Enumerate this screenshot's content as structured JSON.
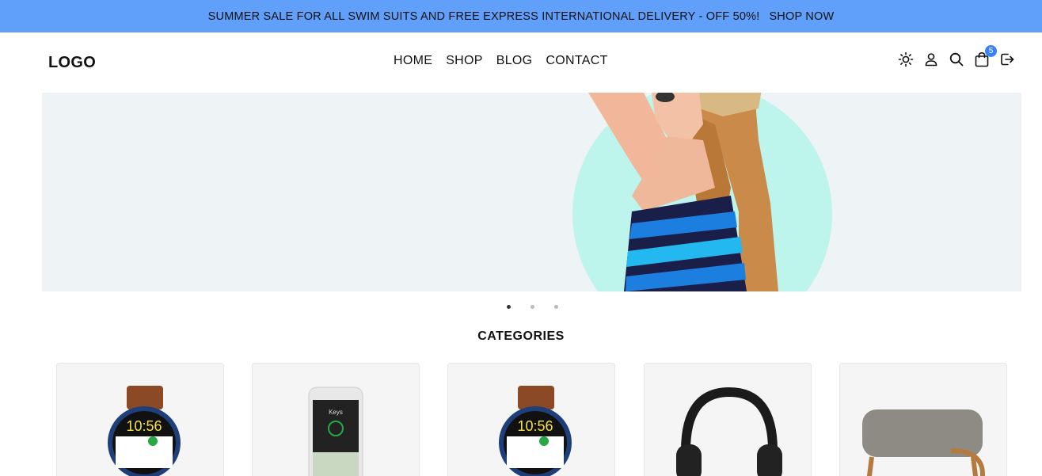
{
  "promo": {
    "text": "SUMMER SALE FOR ALL SWIM SUITS AND FREE EXPRESS INTERNATIONAL DELIVERY - OFF 50%!",
    "link": "SHOP NOW"
  },
  "header": {
    "logo": "LOGO",
    "nav": [
      "HOME",
      "SHOP",
      "BLOG",
      "CONTACT"
    ],
    "icons": [
      "sun-icon",
      "user-icon",
      "search-icon",
      "shopping-bag-icon",
      "logout-icon"
    ],
    "cart_count": "5"
  },
  "slider": {
    "slides": 3,
    "active_slide": 1
  },
  "categories": {
    "title": "CATEGORIES",
    "items": [
      "watch",
      "phone",
      "watch",
      "headphones",
      "ottoman"
    ]
  },
  "colors": {
    "promo_bg": "#60a0fa",
    "hero_bg": "#eef3f5",
    "hero_circle": "#bdf4ec",
    "badge": "#3b82f6"
  }
}
